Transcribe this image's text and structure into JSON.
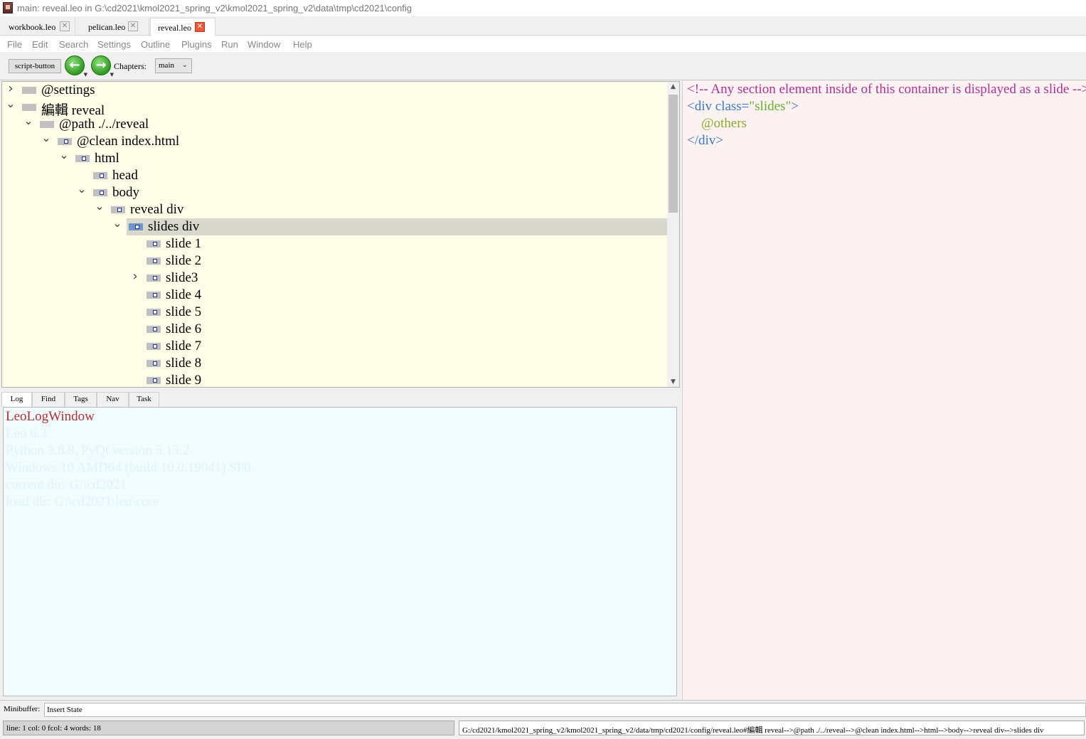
{
  "window": {
    "title": "main: reveal.leo in G:\\cd2021\\kmol2021_spring_v2\\kmol2021_spring_v2\\data\\tmp\\cd2021\\config"
  },
  "doc_tabs": [
    {
      "label": "workbook.leo",
      "active": false
    },
    {
      "label": "pelican.leo",
      "active": false
    },
    {
      "label": "reveal.leo",
      "active": true
    }
  ],
  "menu": [
    "File",
    "Edit",
    "Search",
    "Settings",
    "Outline",
    "Plugins",
    "Run",
    "Window",
    "Help"
  ],
  "toolbar": {
    "script_button": "script-button",
    "chapters_label": "Chapters:",
    "chapter_value": "main"
  },
  "outline": {
    "nodes": [
      {
        "label": "@settings",
        "chevron": "right"
      },
      {
        "label": "編輯 reveal",
        "chevron": "down"
      },
      {
        "label": "@path ./../reveal",
        "chevron": "down"
      },
      {
        "label": "@clean index.html",
        "chevron": "down"
      },
      {
        "label": "html",
        "chevron": "down"
      },
      {
        "label": "head",
        "chevron": "none"
      },
      {
        "label": "body",
        "chevron": "down"
      },
      {
        "label": "reveal div",
        "chevron": "down"
      },
      {
        "label": "slides div",
        "chevron": "down",
        "selected": true
      },
      {
        "label": "slide 1",
        "chevron": "none"
      },
      {
        "label": "slide 2",
        "chevron": "none"
      },
      {
        "label": "slide3",
        "chevron": "right"
      },
      {
        "label": "slide 4",
        "chevron": "none"
      },
      {
        "label": "slide 5",
        "chevron": "none"
      },
      {
        "label": "slide 6",
        "chevron": "none"
      },
      {
        "label": "slide 7",
        "chevron": "none"
      },
      {
        "label": "slide 8",
        "chevron": "none"
      },
      {
        "label": "slide 9",
        "chevron": "none"
      }
    ]
  },
  "log_tabs": [
    "Log",
    "Find",
    "Tags",
    "Nav",
    "Task"
  ],
  "log": {
    "title": "LeoLogWindow",
    "lines": [
      "Leo 6.3",
      "Python 3.8.8, PyQt version 5.15.2",
      "Windows 10 AMD64 (build 10.0.19041) SP0",
      "current dir: G:\\cd2021",
      "load dir: G:\\cd2021\\leo\\core"
    ]
  },
  "body": {
    "lines": [
      {
        "text": "<!-- Any section element inside of this container is displayed as a slide -->",
        "color": "#b0309a"
      },
      {
        "parts": [
          {
            "text": "<div class=",
            "color": "#3a78c8"
          },
          {
            "text": "\"slides\"",
            "color": "#6aae2a"
          },
          {
            "text": ">",
            "color": "#3a78c8"
          }
        ]
      },
      {
        "text": "@others",
        "color": "#8aaa2a",
        "indent": true
      },
      {
        "text": "</div>",
        "color": "#3a78c8"
      }
    ]
  },
  "minibuffer": {
    "label": "Minibuffer:",
    "value": "Insert State"
  },
  "status": {
    "position": "line: 1 col: 0  fcol: 4 words: 18",
    "path": "G:/cd2021/kmol2021_spring_v2/kmol2021_spring_v2/data/tmp/cd2021/config/reveal.leo#編輯 reveal-->@path ./../reveal-->@clean index.html-->html-->body-->reveal div-->slides div"
  }
}
